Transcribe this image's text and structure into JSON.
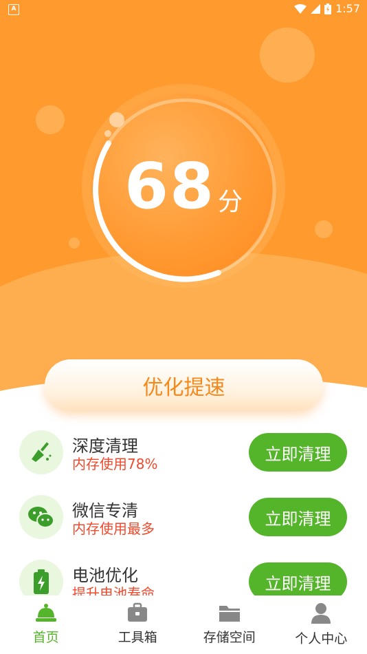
{
  "status_bar": {
    "time": "1:57",
    "notification_icon": "A"
  },
  "score": {
    "value": "68",
    "unit": "分"
  },
  "optimize_button": {
    "label": "优化提速"
  },
  "items": [
    {
      "title": "深度清理",
      "subtitle": "内存使用78%",
      "button": "立即清理",
      "icon": "broom-icon"
    },
    {
      "title": "微信专清",
      "subtitle": "内存使用最多",
      "button": "立即清理",
      "icon": "wechat-icon"
    },
    {
      "title": "电池优化",
      "subtitle": "提升电池寿命",
      "button": "立即清理",
      "icon": "battery-icon"
    }
  ],
  "tabs": [
    {
      "label": "首页",
      "icon": "home-bell-icon",
      "active": true
    },
    {
      "label": "工具箱",
      "icon": "toolbox-icon",
      "active": false
    },
    {
      "label": "存储空间",
      "icon": "folder-icon",
      "active": false
    },
    {
      "label": "个人中心",
      "icon": "person-icon",
      "active": false
    }
  ],
  "colors": {
    "accent_orange": "#ff9a2e",
    "accent_green": "#54b52a",
    "warning_red": "#f04a2e"
  }
}
